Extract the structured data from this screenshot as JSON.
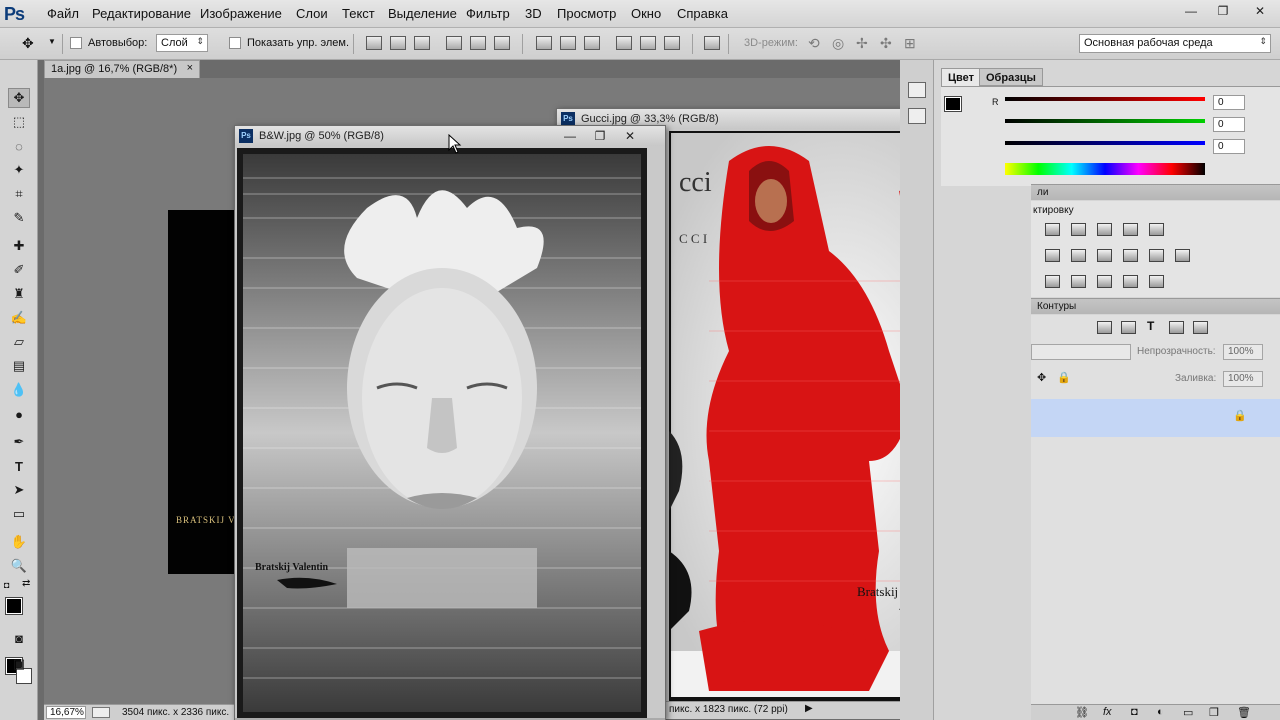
{
  "app": {
    "logo": "Ps"
  },
  "menu": [
    "Файл",
    "Редактирование",
    "Изображение",
    "Слои",
    "Текст",
    "Выделение",
    "Фильтр",
    "3D",
    "Просмотр",
    "Окно",
    "Справка"
  ],
  "window_controls": {
    "minimize": "—",
    "restore": "❐",
    "close": "✕"
  },
  "options_bar": {
    "autoselect_label": "Автовыбор:",
    "autoselect_value": "Слой",
    "show_transform_label": "Показать упр. элем.",
    "mode_3d": "3D-режим:",
    "workspace": "Основная рабочая среда"
  },
  "doc_tab": {
    "title": "1a.jpg @ 16,7% (RGB/8*)",
    "close": "×"
  },
  "doc_black_text": "BRATSKIJ VA",
  "status_bar": {
    "zoom": "16,67%",
    "info": "3504 пикс. x 2336 пикс."
  },
  "window_bw": {
    "title": "B&W.jpg @ 50% (RGB/8)",
    "signature": "Bratskij Valentin",
    "zoom": "50%"
  },
  "window_gucci": {
    "title": "Gucci.jpg @ 33,3% (RGB/8)",
    "signature": "Bratskij Valentin",
    "brand_partial": "cci",
    "brand_partial2": "C C I",
    "status": "пикс. x 1823 пикс. (72 ppi)"
  },
  "color_panel": {
    "tabs": [
      "Цвет",
      "Образцы"
    ],
    "r_label": "R",
    "r": "0",
    "g": "0",
    "b": "0"
  },
  "adjust_panel": {
    "header": "ли",
    "title": "ктировку"
  },
  "layers_panel": {
    "header": "Контуры",
    "opacity_label": "Непрозрачность:",
    "opacity": "100%",
    "fill_label": "Заливка:",
    "fill": "100%"
  },
  "colors": {
    "accent": "#0c3c7a",
    "red_dress": "#d81414",
    "selection": "#c4d6f5"
  }
}
